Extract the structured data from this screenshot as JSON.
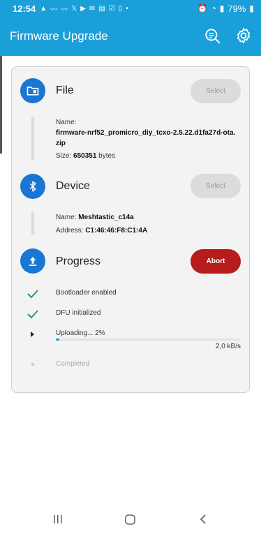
{
  "status_bar": {
    "time": "12:54",
    "battery": "79%",
    "notif_icons": [
      "warning-icon",
      "wave-icon",
      "wave-icon",
      "x-icon",
      "youtube-icon",
      "mail-icon",
      "doc-icon",
      "check-icon",
      "phone-icon",
      "dot-icon"
    ],
    "right_icons": [
      "alarm-icon",
      "wifi-icon",
      "signal-icon",
      "battery-icon"
    ]
  },
  "app_bar": {
    "title": "Firmware Upgrade",
    "accent": "#1a9fd8",
    "actions": [
      "search-list-icon",
      "gear-icon"
    ]
  },
  "file": {
    "title": "File",
    "button": "Select",
    "name_label": "Name:",
    "name_value": "firmware-nrf52_promicro_diy_tcxo-2.5.22.d1fa27d-ota.",
    "name_value_2": "zip",
    "size_label": "Size:",
    "size_value": "650351",
    "size_unit": "bytes"
  },
  "device": {
    "title": "Device",
    "button": "Select",
    "name_label": "Name:",
    "name_value": "Meshtastic_c14a",
    "address_label": "Address:",
    "address_value": "C1:46:46:F8:C1:4A"
  },
  "progress": {
    "title": "Progress",
    "button": "Abort",
    "steps": [
      {
        "label": "Bootloader enabled",
        "state": "done"
      },
      {
        "label": "DFU initialized",
        "state": "done"
      },
      {
        "label": "Uploading... 2%",
        "state": "active"
      },
      {
        "label": "Completed",
        "state": "pending"
      }
    ],
    "upload_fraction": 0.02,
    "speed": "2,0 kB/s"
  },
  "colors": {
    "icon_bg": "#1976d2",
    "check": "#2e9d4f",
    "abort": "#b71c1c"
  }
}
